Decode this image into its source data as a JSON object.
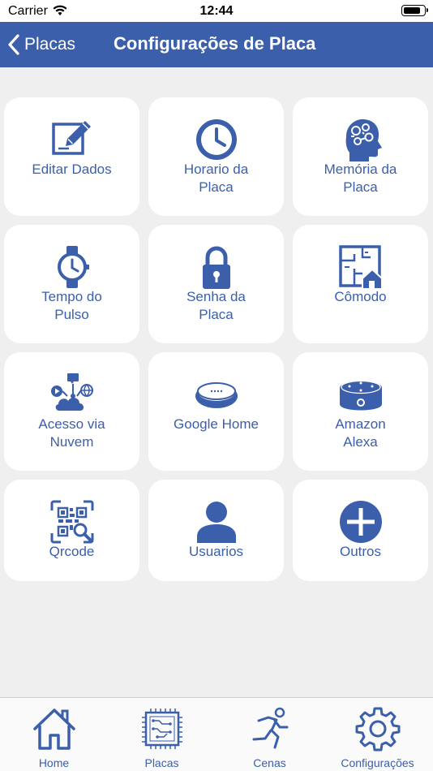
{
  "status_bar": {
    "carrier": "Carrier",
    "time": "12:44",
    "battery_level": 0.85
  },
  "nav": {
    "back_label": "Placas",
    "title": "Configurações de Placa"
  },
  "tiles": [
    {
      "label": "Editar Dados",
      "icon": "edit-icon"
    },
    {
      "label": "Horario da\nPlaca",
      "icon": "clock-icon"
    },
    {
      "label": "Memória da\nPlaca",
      "icon": "brain-head-icon"
    },
    {
      "label": "Tempo do\nPulso",
      "icon": "wristwatch-icon"
    },
    {
      "label": "Senha da\nPlaca",
      "icon": "padlock-icon"
    },
    {
      "label": "Cômodo",
      "icon": "floor-plan-icon"
    },
    {
      "label": "Acesso via\nNuvem",
      "icon": "cloud-network-icon"
    },
    {
      "label": "Google Home",
      "icon": "smart-speaker-icon"
    },
    {
      "label": "Amazon\nAlexa",
      "icon": "echo-dot-icon"
    },
    {
      "label": "Qrcode",
      "icon": "qrcode-scan-icon"
    },
    {
      "label": "Usuarios",
      "icon": "user-icon"
    },
    {
      "label": "Outros",
      "icon": "plus-circle-icon"
    }
  ],
  "tabs": [
    {
      "label": "Home",
      "icon": "house-icon"
    },
    {
      "label": "Placas",
      "icon": "circuit-board-icon"
    },
    {
      "label": "Cenas",
      "icon": "running-person-icon"
    },
    {
      "label": "Configurações",
      "icon": "gear-icon"
    }
  ],
  "colors": {
    "brand": "#3b5fab",
    "background": "#efefef",
    "tile": "#ffffff"
  }
}
